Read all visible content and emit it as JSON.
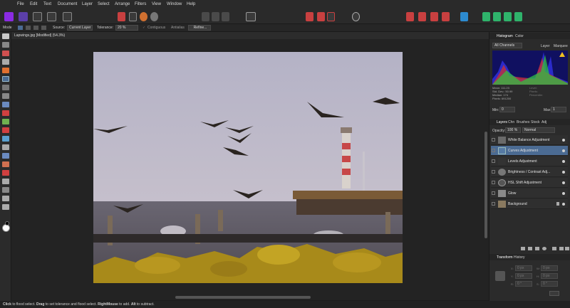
{
  "menu": [
    "File",
    "Edit",
    "Text",
    "Document",
    "Layer",
    "Select",
    "Arrange",
    "Filters",
    "View",
    "Window",
    "Help"
  ],
  "context": {
    "mode_label": "Mode",
    "source_label": "Source:",
    "source_value": "Current Layer",
    "tolerance_label": "Tolerance:",
    "tolerance_value": "20 %",
    "contiguous": "Contiguous",
    "antialias": "Antialias",
    "refine": "Refine..."
  },
  "document": {
    "tab_title": "Lapwings.jpg [Modified] (54.3%)"
  },
  "histogram": {
    "tabs": [
      "Histogram",
      "Color"
    ],
    "channel": "All Channels",
    "layer_opt": "Layer",
    "marquee_opt": "Marquee",
    "stats": [
      "Mean: 111.23",
      "Std. Dev.: 50.99",
      "Median: 174",
      "Pixels: 691200"
    ],
    "stats_right": [
      "Level:",
      "Pixels:",
      "Percentile:"
    ],
    "min_label": "Min:",
    "min_value": "0",
    "max_label": "Max:",
    "max_value": "1"
  },
  "layers_panel": {
    "tabs": [
      "Layers",
      "Chn",
      "Brushes",
      "Stock",
      "Adj"
    ],
    "opacity_label": "Opacity:",
    "opacity_value": "100 %",
    "blend_mode": "Normal",
    "layers": [
      {
        "name": "White Balance Adjustment",
        "selected": false
      },
      {
        "name": "Curves Adjustment",
        "selected": true
      },
      {
        "name": "Levels Adjustment",
        "selected": false
      },
      {
        "name": "Brightness / Contrast Adj...",
        "selected": false
      },
      {
        "name": "HSL Shift Adjustment",
        "selected": false
      },
      {
        "name": "Glow",
        "selected": false
      },
      {
        "name": "Background",
        "selected": false
      }
    ]
  },
  "transform_panel": {
    "tabs": [
      "Transform",
      "History"
    ],
    "x_label": "X:",
    "x_value": "0 px",
    "y_label": "Y:",
    "y_value": "0 px",
    "w_label": "W:",
    "w_value": "0 px",
    "h_label": "H:",
    "h_value": "0 px",
    "r_label": "R:",
    "r_value": "0 °",
    "s_label": "S:",
    "s_value": "0 °"
  },
  "status": {
    "part1": "Click",
    "part2": " to flood select. ",
    "part3": "Drag",
    "part4": " to set tolerance and flood select. ",
    "part5": "RightMouse",
    "part6": " to add. ",
    "part7": "Alt",
    "part8": " to subtract."
  },
  "colors": {
    "accent": "#4b6b93",
    "persona_purple": "#8a2be2",
    "ui_dark": "#2b2b2b"
  }
}
